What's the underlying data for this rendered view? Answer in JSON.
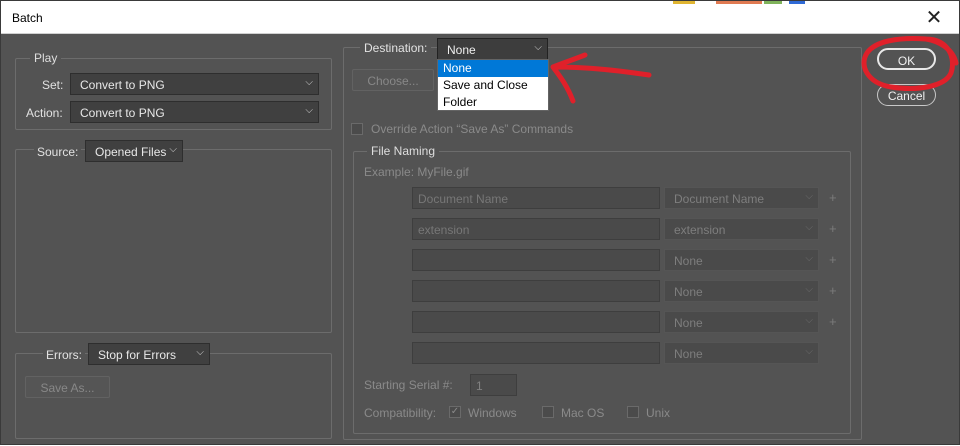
{
  "window": {
    "title": "Batch",
    "close_glyph": "✕"
  },
  "play": {
    "legend": "Play",
    "set_label": "Set:",
    "set_value": "Convert to PNG",
    "action_label": "Action:",
    "action_value": "Convert to PNG"
  },
  "source": {
    "label": "Source:",
    "value": "Opened Files"
  },
  "errors": {
    "label": "Errors:",
    "value": "Stop for Errors",
    "save_as": "Save As..."
  },
  "destination": {
    "label": "Destination:",
    "value": "None",
    "choose": "Choose...",
    "options": [
      "None",
      "Save and Close",
      "Folder"
    ],
    "selected_index": 0,
    "override_label": "Override Action “Save As” Commands"
  },
  "file_naming": {
    "legend": "File Naming",
    "example": "Example: MyFile.gif",
    "rows": [
      {
        "text": "Document Name",
        "select": "Document Name",
        "plus": true
      },
      {
        "text": "extension",
        "select": "extension",
        "plus": true
      },
      {
        "text": "",
        "select": "None",
        "plus": true
      },
      {
        "text": "",
        "select": "None",
        "plus": true
      },
      {
        "text": "",
        "select": "None",
        "plus": true
      },
      {
        "text": "",
        "select": "None",
        "plus": false
      }
    ],
    "serial_label": "Starting Serial #:",
    "serial_value": "1",
    "compat_label": "Compatibility:",
    "compat": [
      {
        "label": "Windows",
        "checked": true
      },
      {
        "label": "Mac OS",
        "checked": false
      },
      {
        "label": "Unix",
        "checked": false
      }
    ]
  },
  "buttons": {
    "ok": "OK",
    "cancel": "Cancel"
  },
  "icons": {
    "chevron": "chevron-down-icon",
    "plus": "plus-icon",
    "check": "check-icon"
  },
  "colors": {
    "panel": "#535353",
    "highlight": "#0078d7",
    "annotation": "#e0202a"
  }
}
